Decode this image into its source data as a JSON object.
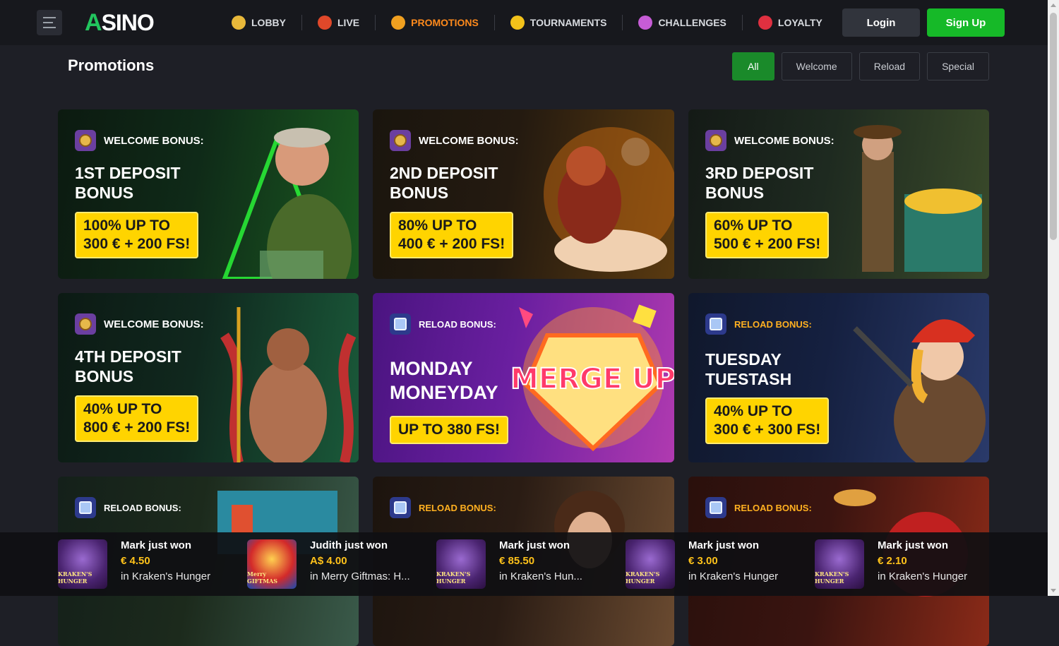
{
  "header": {
    "logo_text": "SINO",
    "logo_mark": "A",
    "nav": [
      {
        "label": "LOBBY",
        "icon": "slot-machine-icon",
        "color": "#e8b83a"
      },
      {
        "label": "LIVE",
        "icon": "live-badge-icon",
        "color": "#e0482a"
      },
      {
        "label": "PROMOTIONS",
        "icon": "megaphone-icon",
        "color": "#f0a020",
        "active": true
      },
      {
        "label": "TOURNAMENTS",
        "icon": "trophy-icon",
        "color": "#f2c21a"
      },
      {
        "label": "CHALLENGES",
        "icon": "target-icon",
        "color": "#c65cd6"
      },
      {
        "label": "LOYALTY",
        "icon": "bow-icon",
        "color": "#e03040"
      }
    ],
    "login_label": "Login",
    "signup_label": "Sign Up"
  },
  "page": {
    "title": "Promotions",
    "filters": [
      "All",
      "Welcome",
      "Reload",
      "Special"
    ]
  },
  "cards": [
    {
      "tag": "WELCOME BONUS:",
      "title_1": "1ST DEPOSIT",
      "title_2": "BONUS",
      "offer_1": "100% UP TO",
      "offer_2": "300 € + 200 FS!",
      "bg": "#0f2a18"
    },
    {
      "tag": "WELCOME BONUS:",
      "title_1": "2ND DEPOSIT",
      "title_2": "BONUS",
      "offer_1": "80% UP TO",
      "offer_2": "400 € + 200 FS!",
      "bg": "#241a10"
    },
    {
      "tag": "WELCOME BONUS:",
      "title_1": "3RD DEPOSIT",
      "title_2": "BONUS",
      "offer_1": "60% UP TO",
      "offer_2": "500 € + 200 FS!",
      "bg": "#1e2a20"
    },
    {
      "tag": "WELCOME BONUS:",
      "title_1": "4TH DEPOSIT",
      "title_2": "BONUS",
      "offer_1": "40% UP TO",
      "offer_2": "800 € + 200 FS!",
      "bg": "#10281e"
    },
    {
      "tag": "RELOAD BONUS:",
      "title_1": "MONDAY",
      "title_2": "MONEYDAY",
      "offer_1": "UP TO 380 FS!",
      "offer_2": "",
      "bg": "#6a1fa0"
    },
    {
      "tag": "RELOAD BONUS:",
      "title_1": "TUESDAY",
      "title_2": "TUESTASH",
      "offer_1": "40% UP TO",
      "offer_2": "300 € + 300 FS!",
      "bg": "#152040"
    },
    {
      "tag": "RELOAD BONUS:",
      "bg": "#1c2a1c"
    },
    {
      "tag": "RELOAD BONUS:",
      "bg": "#2a1c14"
    },
    {
      "tag": "RELOAD BONUS:",
      "bg": "#3a1410"
    }
  ],
  "art": {
    "merge_up": "MERGE UP"
  },
  "ticker": [
    {
      "who": "Mark just won",
      "amount": "€ 4.50",
      "game": "in Kraken's Hunger",
      "thumb": "KRAKEN'S HUNGER"
    },
    {
      "who": "Judith just won",
      "amount": "A$ 4.00",
      "game": "in Merry Giftmas: H...",
      "thumb": "Merry GIFTMAS"
    },
    {
      "who": "Mark just won",
      "amount": "€ 85.50",
      "game": "in Kraken's Hun...",
      "thumb": "KRAKEN'S HUNGER"
    },
    {
      "who": "Mark just won",
      "amount": "€ 3.00",
      "game": "in Kraken's Hunger",
      "thumb": "KRAKEN'S HUNGER"
    },
    {
      "who": "Mark just won",
      "amount": "€ 2.10",
      "game": "in Kraken's Hunger",
      "thumb": "KRAKEN'S HUNGER"
    }
  ]
}
